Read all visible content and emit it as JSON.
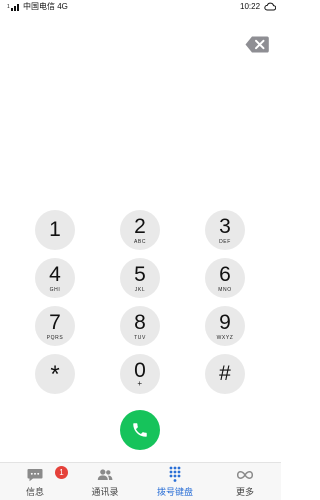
{
  "status_bar": {
    "signal_label": "1",
    "carrier": "中国电信 4G",
    "time": "10:22"
  },
  "keypad": {
    "keys": [
      {
        "digit": "1",
        "letters": ""
      },
      {
        "digit": "2",
        "letters": "ABC"
      },
      {
        "digit": "3",
        "letters": "DEF"
      },
      {
        "digit": "4",
        "letters": "GHI"
      },
      {
        "digit": "5",
        "letters": "JKL"
      },
      {
        "digit": "6",
        "letters": "MNO"
      },
      {
        "digit": "7",
        "letters": "PQRS"
      },
      {
        "digit": "8",
        "letters": "TUV"
      },
      {
        "digit": "9",
        "letters": "WXYZ"
      },
      {
        "digit": "*",
        "letters": ""
      },
      {
        "digit": "0",
        "letters": "+"
      },
      {
        "digit": "#",
        "letters": ""
      }
    ]
  },
  "colors": {
    "call_green": "#16c35b",
    "key_gray": "#e9e9e9",
    "active_tab_blue": "#2a6fd6",
    "badge_red": "#e5413a"
  },
  "icons": {
    "delete": "backspace-icon",
    "call": "phone-icon",
    "messages": "chat-bubble-icon",
    "contacts": "people-icon",
    "keypad": "dialpad-icon",
    "more": "infinity-icon"
  },
  "bottom_nav": {
    "messages_badge": "1",
    "tabs": [
      {
        "label": "信息",
        "active": false
      },
      {
        "label": "通讯录",
        "active": false
      },
      {
        "label": "拨号键盘",
        "active": true
      },
      {
        "label": "更多",
        "active": false
      }
    ]
  }
}
